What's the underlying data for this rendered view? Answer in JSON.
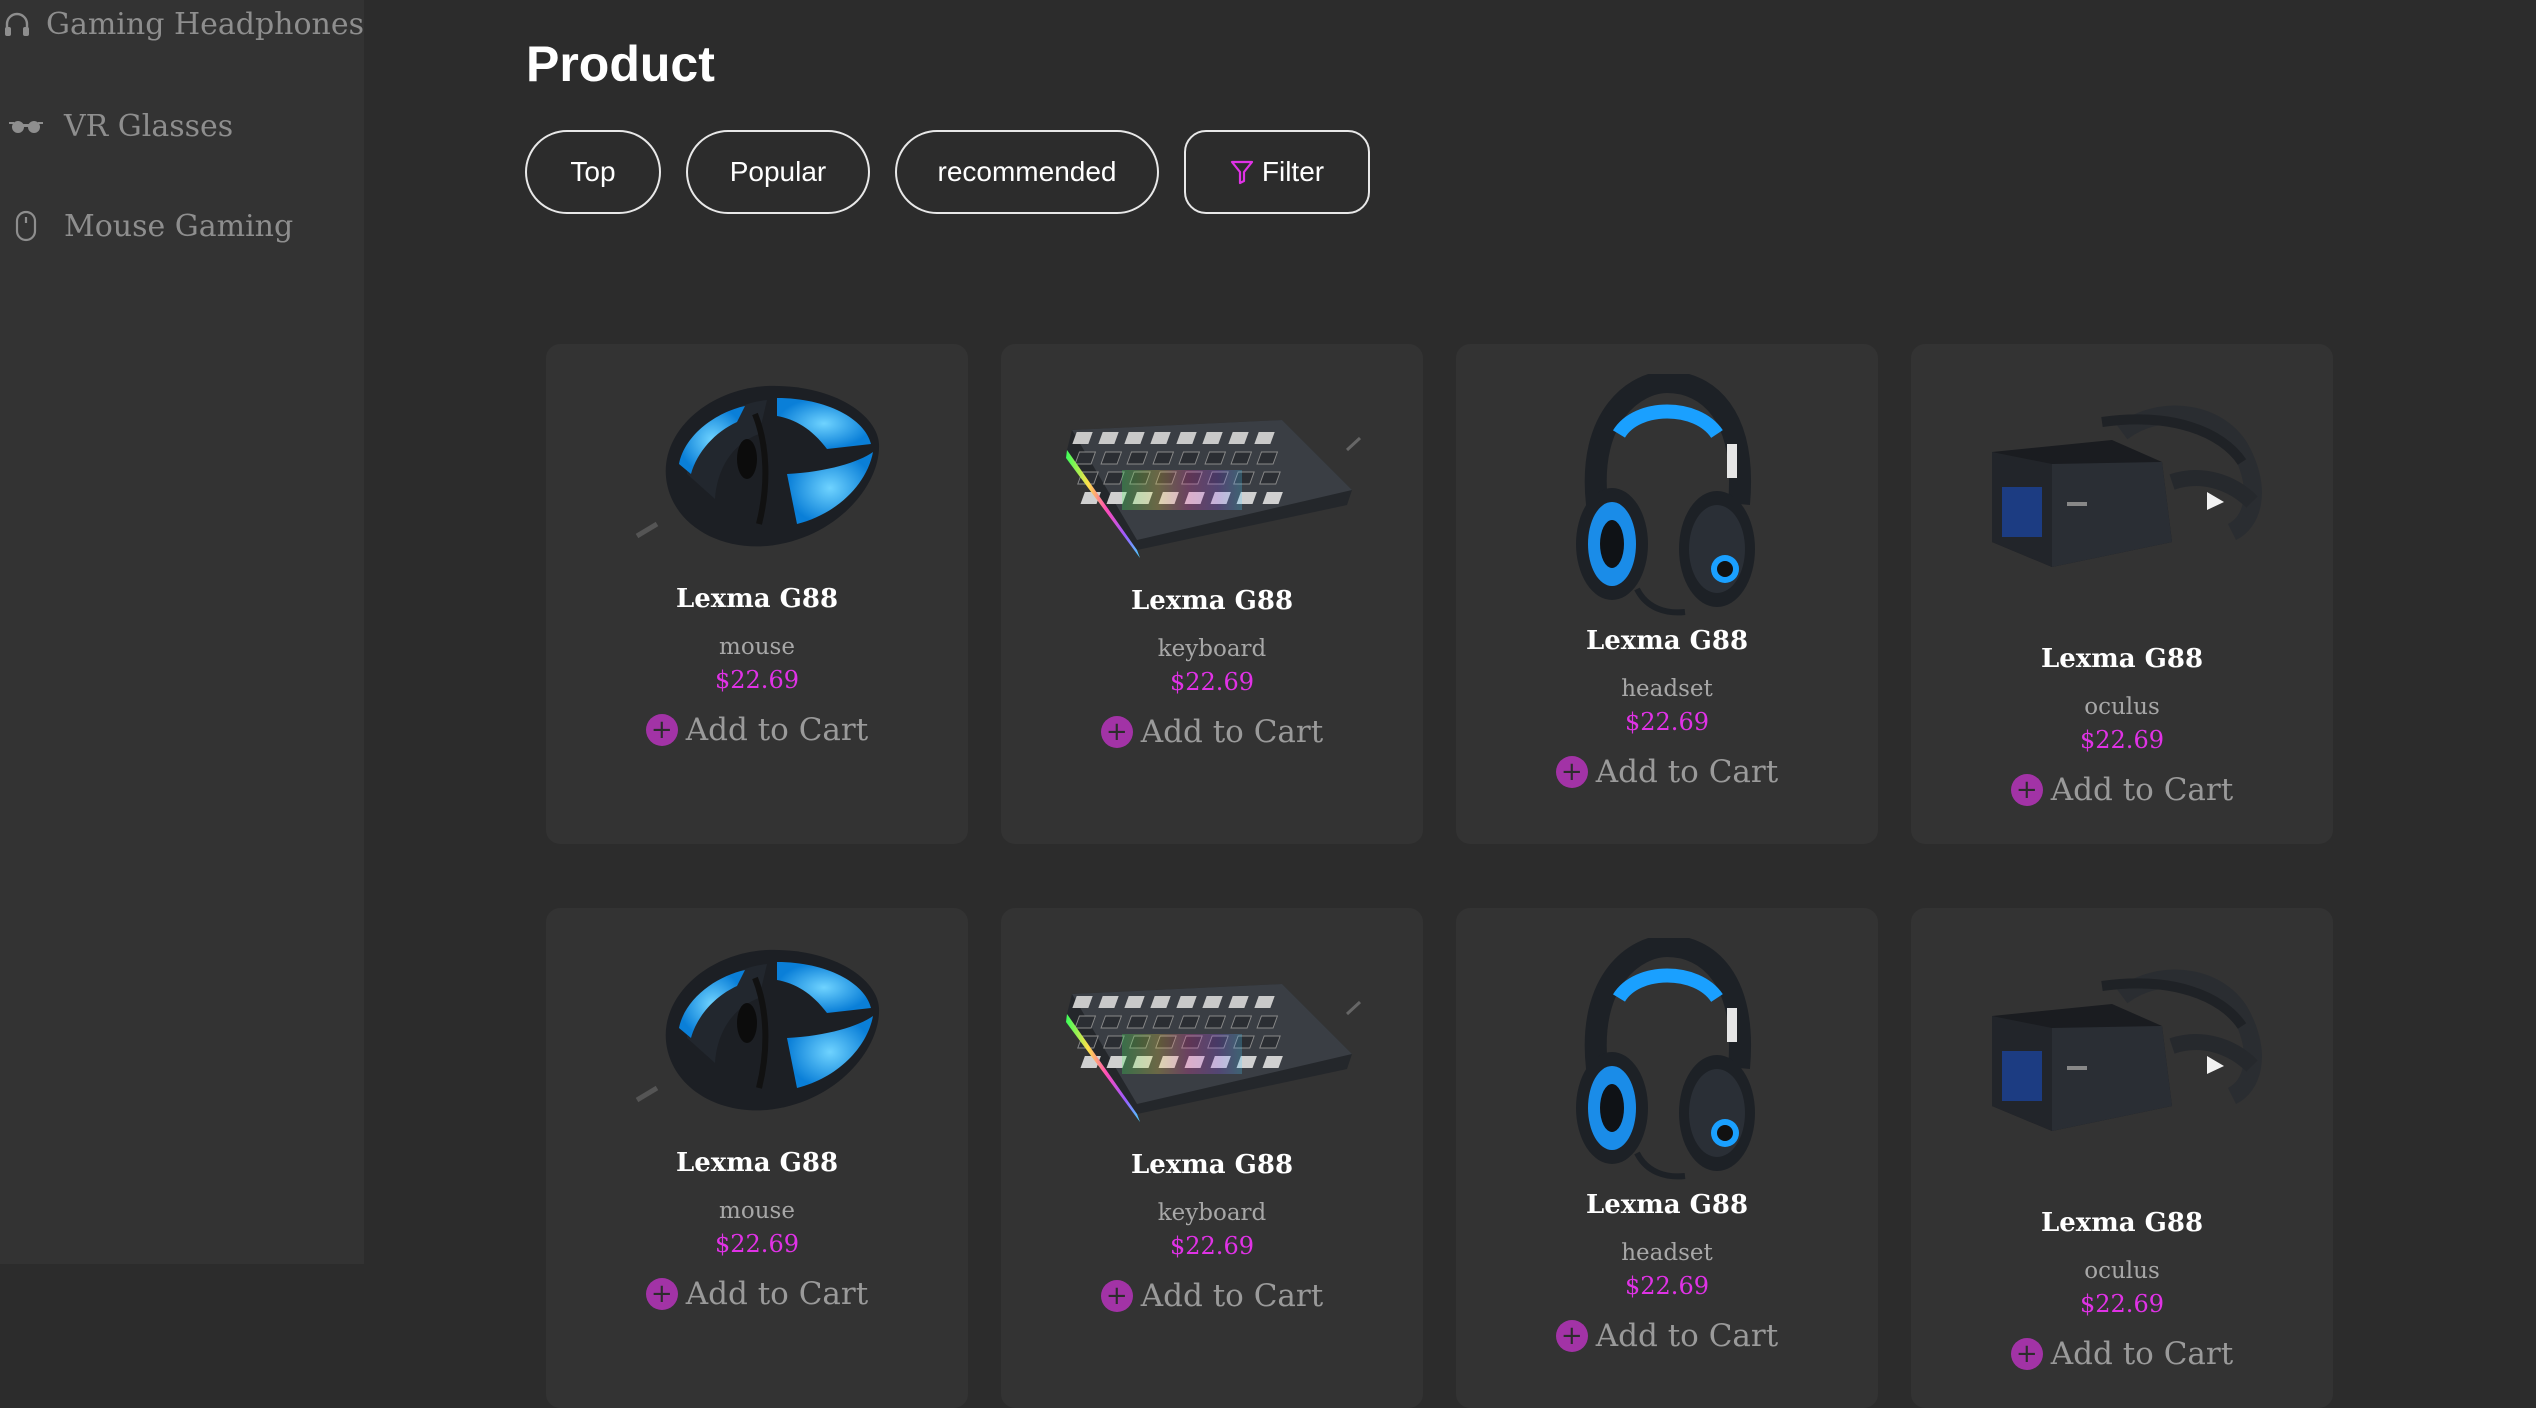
{
  "sidebar": {
    "items": [
      {
        "label": "Gaming Headphones",
        "icon": "headphones-icon"
      },
      {
        "label": "VR Glasses",
        "icon": "vr-glasses-icon"
      },
      {
        "label": "Mouse Gaming",
        "icon": "mouse-icon"
      }
    ]
  },
  "header": {
    "title": "Product",
    "filters": [
      "Top",
      "Popular",
      "recommended"
    ],
    "filter_button": "Filter",
    "accent_color": "#e032e6"
  },
  "products": [
    {
      "name": "Lexma G88",
      "category": "mouse",
      "price": "$22.69",
      "cta": "Add to Cart",
      "image": "gaming-mouse"
    },
    {
      "name": "Lexma G88",
      "category": "keyboard",
      "price": "$22.69",
      "cta": "Add to Cart",
      "image": "rgb-keyboard"
    },
    {
      "name": "Lexma G88",
      "category": "headset",
      "price": "$22.69",
      "cta": "Add to Cart",
      "image": "gaming-headset"
    },
    {
      "name": "Lexma G88",
      "category": "oculus",
      "price": "$22.69",
      "cta": "Add to Cart",
      "image": "vr-headset"
    },
    {
      "name": "Lexma G88",
      "category": "mouse",
      "price": "$22.69",
      "cta": "Add to Cart",
      "image": "gaming-mouse"
    },
    {
      "name": "Lexma G88",
      "category": "keyboard",
      "price": "$22.69",
      "cta": "Add to Cart",
      "image": "rgb-keyboard"
    },
    {
      "name": "Lexma G88",
      "category": "headset",
      "price": "$22.69",
      "cta": "Add to Cart",
      "image": "gaming-headset"
    },
    {
      "name": "Lexma G88",
      "category": "oculus",
      "price": "$22.69",
      "cta": "Add to Cart",
      "image": "vr-headset"
    }
  ]
}
